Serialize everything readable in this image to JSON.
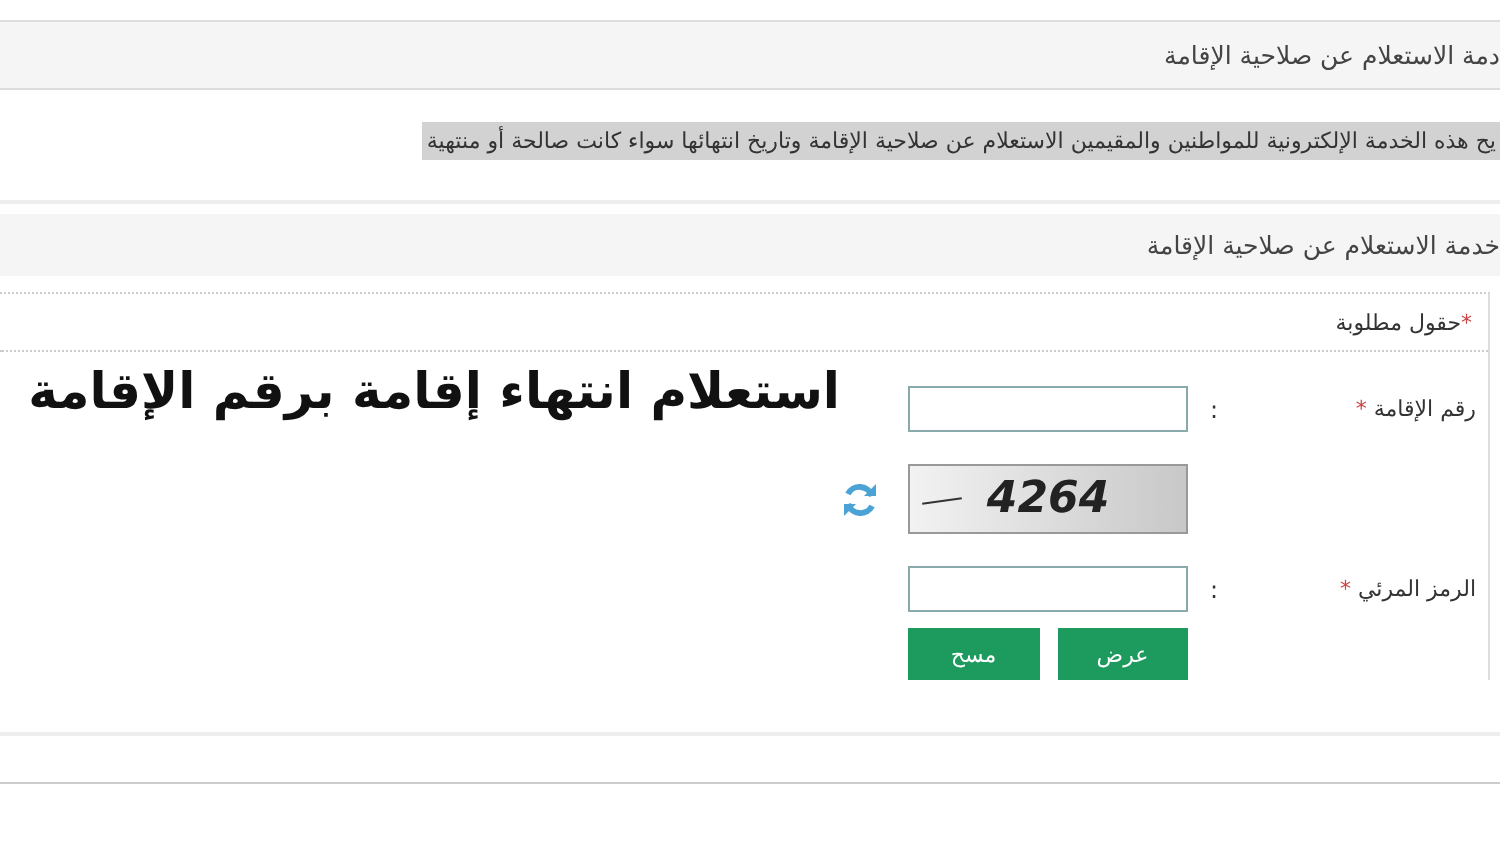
{
  "panel_1": {
    "title": "دمة الاستعلام عن صلاحية الإقامة",
    "description": "يح هذه الخدمة الإلكترونية للمواطنين والمقيمين الاستعلام عن صلاحية الإقامة وتاريخ انتهائها سواء كانت صالحة أو منتهية"
  },
  "panel_2": {
    "title": "خدمة الاستعلام عن صلاحية الإقامة",
    "required_note": {
      "mark": "*",
      "text": "حقول مطلوبة"
    }
  },
  "overlay_heading": "استعلام انتهاء إقامة برقم الإقامة",
  "form": {
    "fields": [
      {
        "kind": "input",
        "label": "رقم الإقامة",
        "required_mark": "*",
        "separator": ":"
      },
      {
        "kind": "captcha",
        "captcha_text": "4264"
      },
      {
        "kind": "input",
        "label": "الرمز المرئي",
        "required_mark": "*",
        "separator": ":"
      }
    ],
    "buttons": [
      "عرض",
      "مسح"
    ]
  }
}
